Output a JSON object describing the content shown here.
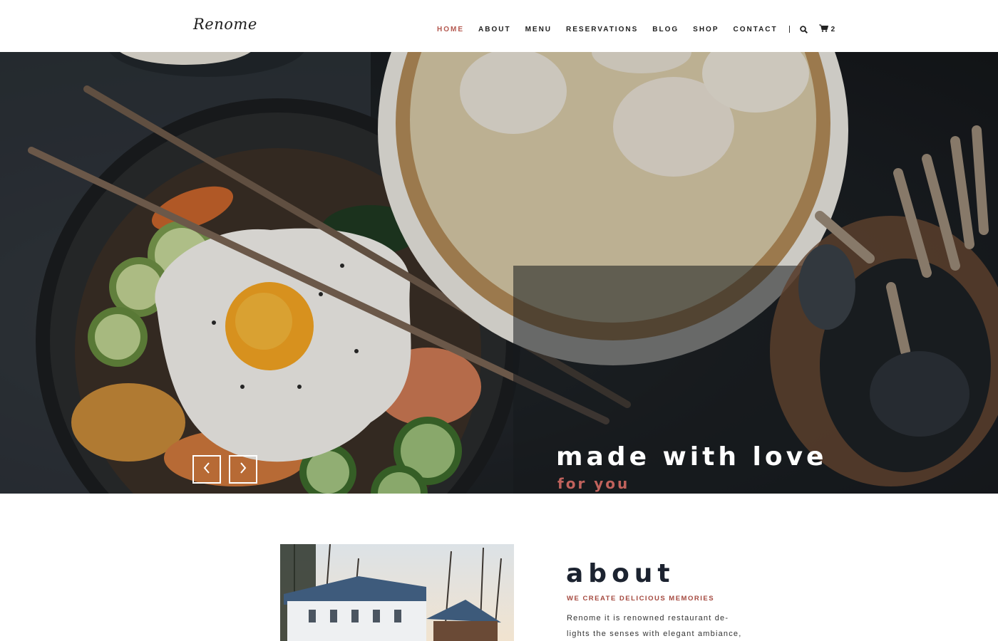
{
  "brand": {
    "logo_text": "Renome"
  },
  "nav": {
    "items": [
      {
        "label": "HOME",
        "active": true
      },
      {
        "label": "ABOUT"
      },
      {
        "label": "MENU"
      },
      {
        "label": "RESERVATIONS"
      },
      {
        "label": "BLOG"
      },
      {
        "label": "SHOP"
      },
      {
        "label": "CONTACT"
      }
    ],
    "search_icon": "search-icon",
    "cart_icon": "cart-icon",
    "cart_count": "2"
  },
  "hero": {
    "title": "made with love",
    "subtitle": "for you",
    "prev_icon": "chevron-left-icon",
    "next_icon": "chevron-right-icon"
  },
  "about": {
    "title": "about",
    "tagline": "WE CREATE DELICIOUS MEMORIES",
    "text_line1": "Renome it is renowned restaurant de-",
    "text_line2": "lights the senses with elegant ambiance,"
  },
  "colors": {
    "accent": "#b4584f",
    "hero_subtitle": "#c0625c",
    "tagline": "#a4493f",
    "heading_dark": "#1c2330"
  }
}
